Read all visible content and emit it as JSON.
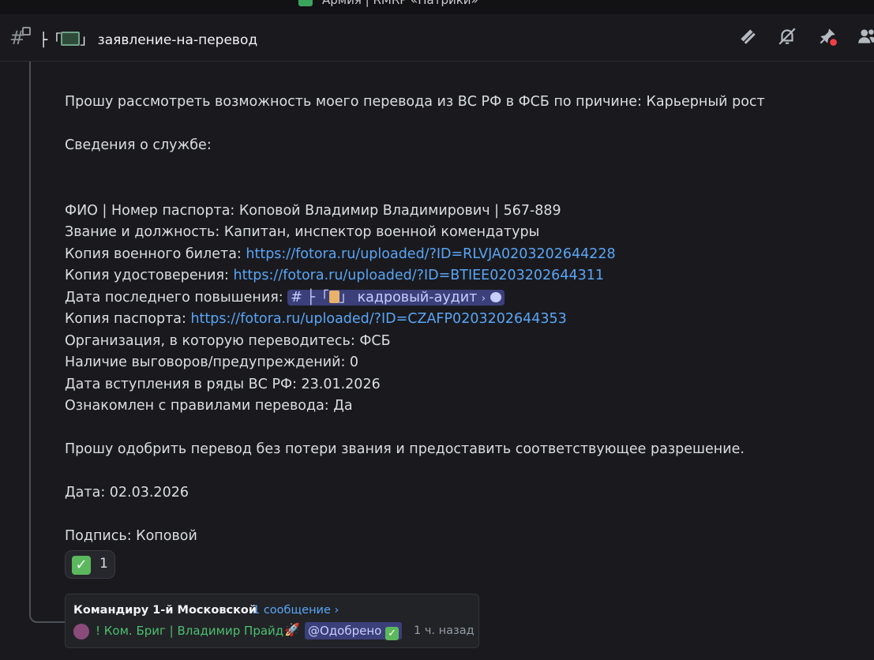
{
  "window": {
    "server_title": "Армия | RMRP «Патрики»"
  },
  "header": {
    "channel_name_prefix": "├「",
    "channel_name_suffix": "」 заявление-на-перевод",
    "icons": [
      "threads-icon",
      "mute-icon",
      "pinned-icon",
      "member-list-icon"
    ]
  },
  "message": {
    "request_line": "Прошу рассмотреть возможность моего перевода из ВС РФ в ФСБ по причине: Карьерный рост",
    "service_info_header": "Сведения о службе:",
    "fio": "ФИО | Номер паспорта: Коповой Владимир Владимирович | 567-889",
    "rank": "Звание и должность: Капитан, инспектор военной комендатуры",
    "military_id_label": "Копия военного билета: ",
    "military_id_url": "https://fotora.ru/uploaded/?ID=RLVJA0203202644228",
    "certificate_label": "Копия удостоверения: ",
    "certificate_url": "https://fotora.ru/uploaded/?ID=BTIEE0203202644311",
    "last_promotion_label": "Дата последнего повышения: ",
    "last_promotion_channel_prefix": "# ├「",
    "last_promotion_channel_suffix": "」 кадровый-аудит",
    "last_promotion_chevron": "›",
    "passport_label": "Копия паспорта: ",
    "passport_url": "https://fotora.ru/uploaded/?ID=CZAFP0203202644353",
    "organization": "Организация, в которую переводитесь: ФСБ",
    "reprimands": "Наличие выговоров/предупреждений: 0",
    "enlistment_date": "Дата вступления в ряды ВС РФ:  23.01.2026",
    "rules_ack": "Ознакомлен с правилами перевода:  Да",
    "approval_request": "Прошу одобрить перевод без потери звания и предоставить соответствующее разрешение.",
    "date": "Дата:  02.03.2026",
    "signature": "Подпись: Коповой"
  },
  "reaction": {
    "emoji": "✓",
    "count": "1"
  },
  "thread": {
    "name": "Командиру 1-й Московской",
    "message_count": "1 сообщение ›",
    "last_author": "! Ком. Бриг | Владимир Прайд",
    "author_badge": "🚀",
    "role_mention": "@Одобрено",
    "role_check": "✓",
    "time": "1 ч. назад"
  },
  "colors": {
    "background": "#1a1a1e",
    "link": "#5aa5f5",
    "mention_bg": "#3b3f7a",
    "author_green": "#4cbf6f"
  }
}
